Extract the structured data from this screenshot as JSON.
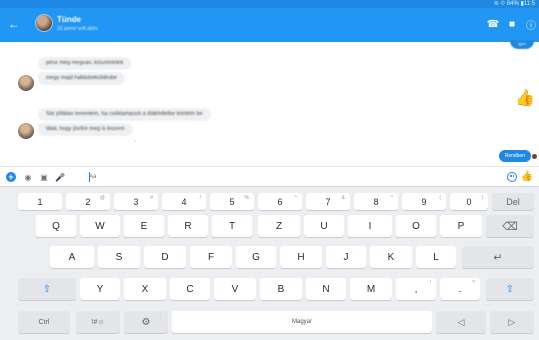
{
  "status_bar": {
    "text": "≋ ⟐ 84% ▮11:5"
  },
  "app_bar": {
    "back_glyph": "←",
    "contact_name": "Tünde",
    "contact_status": "15 perce volt aktív.",
    "call_icon": "☎",
    "video_icon": "■",
    "info_icon": "ⓘ"
  },
  "chat": {
    "top_bubble": "igen",
    "incoming_group_1": [
      "pénz még megvan, köszöntelek",
      "megy majd hallásbeküldésbe"
    ],
    "incoming_group_2": [
      "Sár jóllátan teremtem, ha csóktampuck a diákfoltelbe bónbím be",
      "látat, hogy jövőre meg is leszem"
    ],
    "seen_mark": "✓",
    "outgoing": "Rendben",
    "like_glyph": "👍"
  },
  "composer": {
    "input_value": "Aa",
    "plus_glyph": "+",
    "camera_glyph": "◉",
    "gallery_glyph": "▣",
    "mic_glyph": "🎤",
    "like_glyph": "👍"
  },
  "keyboard": {
    "number_row": [
      {
        "key": "1",
        "sup": ""
      },
      {
        "key": "2",
        "sup": "@"
      },
      {
        "key": "3",
        "sup": "#"
      },
      {
        "key": "4",
        "sup": "/"
      },
      {
        "key": "5",
        "sup": "%"
      },
      {
        "key": "6",
        "sup": "^"
      },
      {
        "key": "7",
        "sup": "&"
      },
      {
        "key": "8",
        "sup": "*"
      },
      {
        "key": "9",
        "sup": "("
      },
      {
        "key": "0",
        "sup": ")"
      }
    ],
    "del_label": "Del",
    "row_q": [
      "Q",
      "W",
      "E",
      "R",
      "T",
      "Z",
      "U",
      "I",
      "O",
      "P"
    ],
    "backspace_glyph": "⌫",
    "row_a": [
      "A",
      "S",
      "D",
      "F",
      "G",
      "H",
      "J",
      "K",
      "L"
    ],
    "enter_glyph": "↵",
    "shift_glyph": "⇧",
    "row_y": [
      "Y",
      "X",
      "C",
      "V",
      "B",
      "N",
      "M"
    ],
    "comma": {
      "key": ",",
      "sup": "!"
    },
    "period": {
      "key": ".",
      "sup": "?"
    },
    "ctrl_label": "Ctrl",
    "symbols_label": "!#☺",
    "settings_glyph": "⚙",
    "settings_sup": "⋮",
    "space_label": "Magyar",
    "left_arrow": "◁",
    "right_arrow": "▷"
  }
}
